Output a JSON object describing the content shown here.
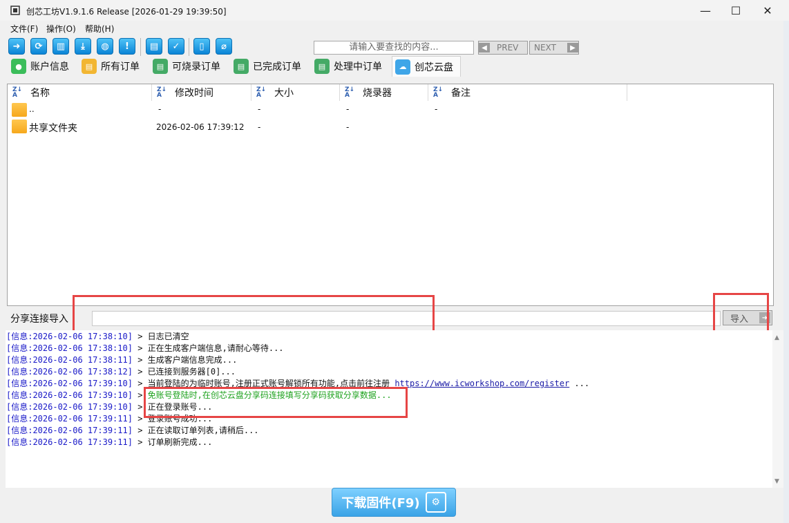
{
  "window": {
    "title": "创芯工坊V1.9.1.6 Release [2026-01-29 19:39:50]",
    "minimize": "—",
    "maximize": "☐",
    "close": "✕"
  },
  "menu": [
    "文件(F)",
    "操作(O)",
    "帮助(H)"
  ],
  "toolbar": {
    "icons": [
      "login-icon",
      "refresh-icon",
      "clear-icon",
      "download-icon",
      "web-icon",
      "info-icon",
      "chart-icon",
      "check-icon",
      "save-icon",
      "clip-icon"
    ],
    "search_placeholder": "请输入要查找的内容...",
    "prev_label": "PREV",
    "next_label": "NEXT"
  },
  "tabs": [
    {
      "label": "账户信息",
      "icon": "user-icon",
      "color": "#3bbd5a"
    },
    {
      "label": "所有订单",
      "icon": "order-icon",
      "color": "#f2b632"
    },
    {
      "label": "可烧录订单",
      "icon": "burnable-icon",
      "color": "#44aa66"
    },
    {
      "label": "已完成订单",
      "icon": "completed-icon",
      "color": "#44aa66"
    },
    {
      "label": "处理中订单",
      "icon": "processing-icon",
      "color": "#44aa66"
    },
    {
      "label": "创芯云盘",
      "icon": "cloud-icon",
      "color": "#3fa6e8",
      "active": true
    }
  ],
  "file_list": {
    "columns": [
      "名称",
      "修改时间",
      "大小",
      "烧录器",
      "备注"
    ],
    "rows": [
      {
        "name": "..",
        "modified": "-",
        "size": "-",
        "programmer": "-",
        "note": "-"
      },
      {
        "name": "共享文件夹",
        "modified": "2026-02-06 17:39:12",
        "size": "-",
        "programmer": "-",
        "note": ""
      }
    ]
  },
  "share": {
    "label": "分享连接导入",
    "input_value": "",
    "import_label": "导入"
  },
  "log": [
    {
      "tag": "[信息:2026-02-06 17:38:10]",
      "msg": "> 日志已清空"
    },
    {
      "tag": "[信息:2026-02-06 17:38:10]",
      "msg": "> 正在生成客户端信息,请耐心等待..."
    },
    {
      "tag": "[信息:2026-02-06 17:38:11]",
      "msg": "> 生成客户端信息完成..."
    },
    {
      "tag": "[信息:2026-02-06 17:38:12]",
      "msg": "> 已连接到服务器[0]..."
    },
    {
      "tag": "[信息:2026-02-06 17:39:10]",
      "msg": "> 当前登陆的为临时账号,注册正式账号解锁所有功能,点击前往注册",
      "link": "https://www.icworkshop.com/register",
      "tail": " ..."
    },
    {
      "tag": "[信息:2026-02-06 17:39:10]",
      "msg": "> ",
      "green": "免账号登陆时,在创芯云盘分享码连接填写分享码获取分享数据..."
    },
    {
      "tag": "[信息:2026-02-06 17:39:10]",
      "msg": "> 正在登录账号..."
    },
    {
      "tag": "[信息:2026-02-06 17:39:11]",
      "msg": "> 登录账号成功..."
    },
    {
      "tag": "[信息:2026-02-06 17:39:11]",
      "msg": "> 正在读取订单列表,请稍后..."
    },
    {
      "tag": "[信息:2026-02-06 17:39:11]",
      "msg": "> 订单刷新完成..."
    }
  ],
  "download_button": "下载固件(F9)",
  "colors": {
    "accent": "#0a84d6",
    "highlight": "#e64545",
    "log_tag": "#1818c8",
    "log_green": "#1ea21e"
  }
}
